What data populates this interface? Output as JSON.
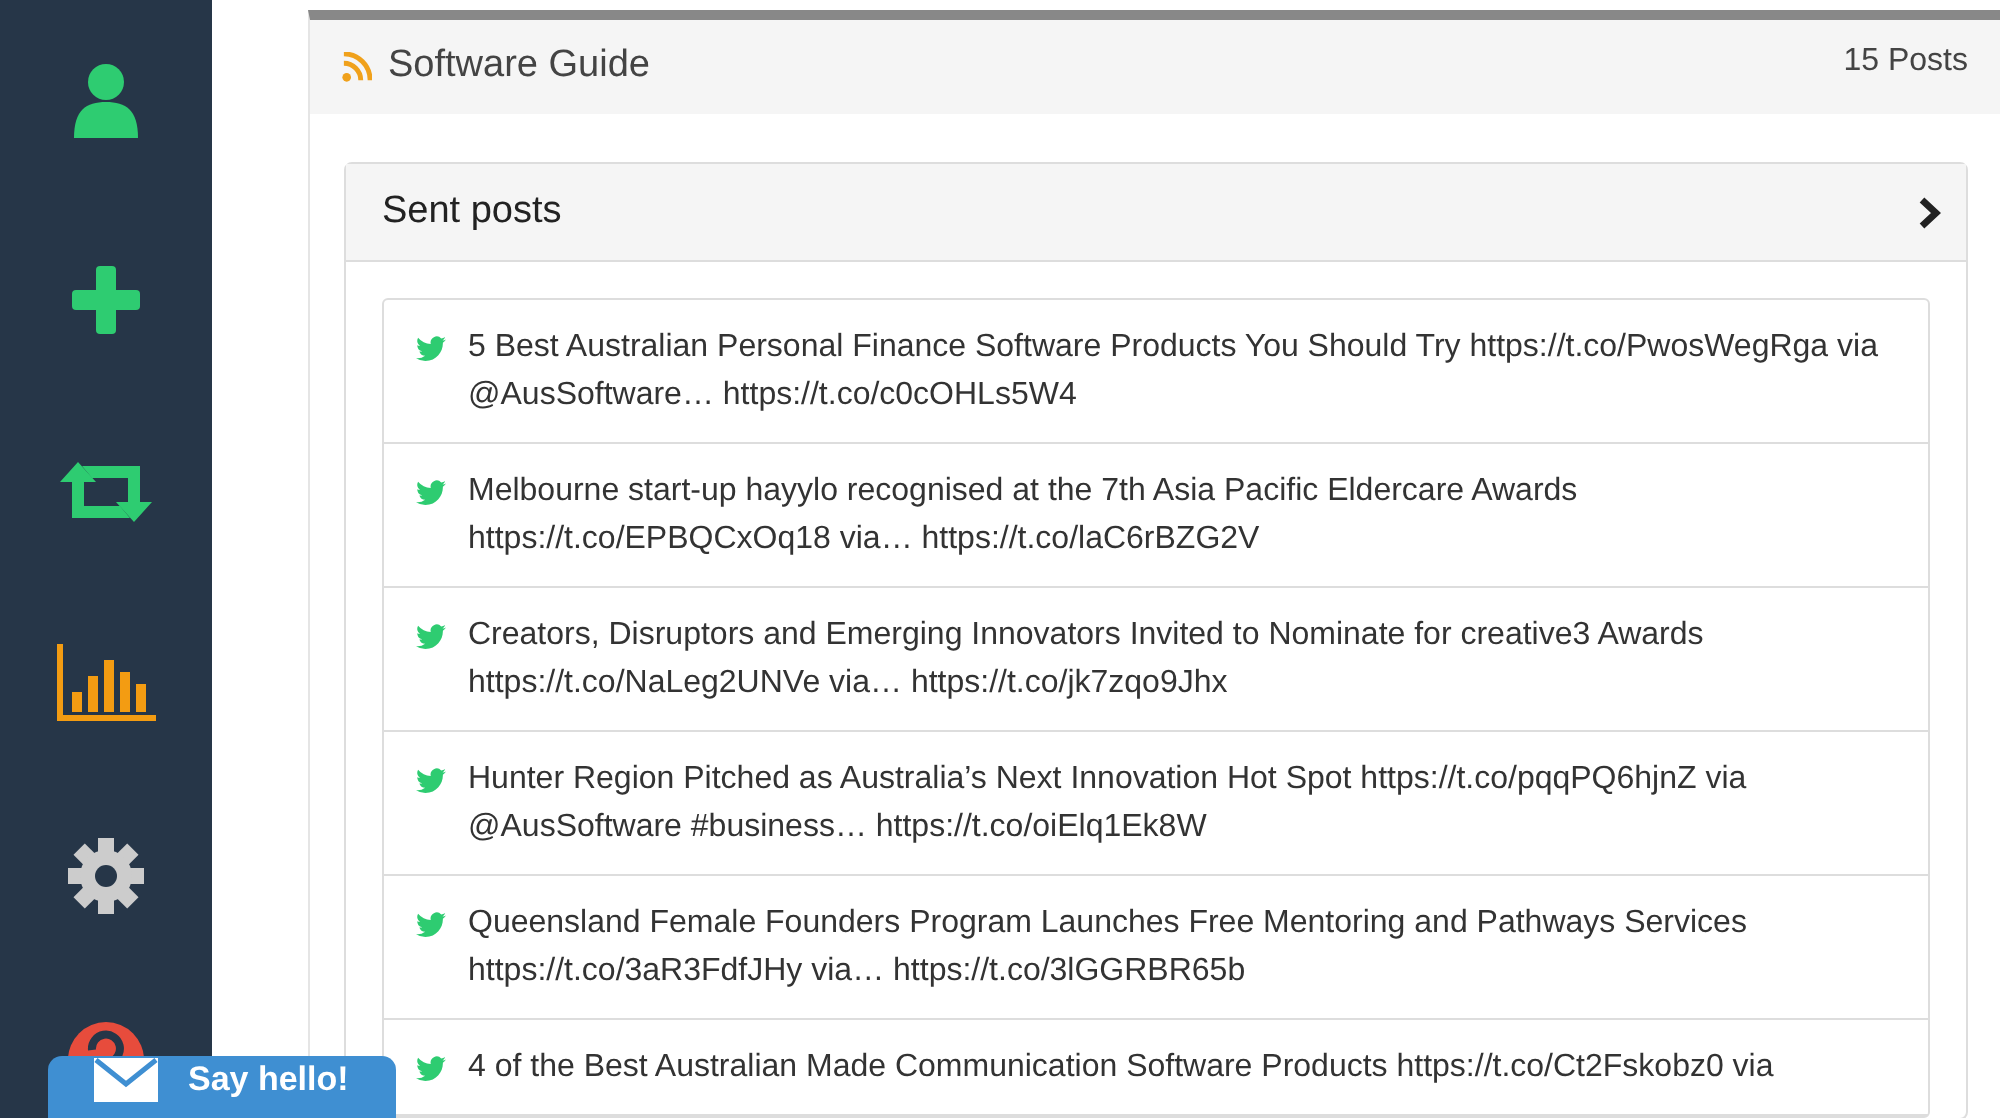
{
  "sidebar": {
    "items": [
      {
        "kind": "user",
        "color": "#2ecc71"
      },
      {
        "kind": "add",
        "color": "#2ecc71"
      },
      {
        "kind": "retweet",
        "color": "#2ecc71"
      },
      {
        "kind": "chart",
        "color": "#f39c12"
      },
      {
        "kind": "settings",
        "color": "#cccccc"
      },
      {
        "kind": "help",
        "color": "#e74c3c"
      }
    ]
  },
  "panel": {
    "title": "Software Guide",
    "count": "15 Posts"
  },
  "sent_posts": {
    "title": "Sent posts",
    "posts": [
      {
        "text": "5 Best Australian Personal Finance Software Products You Should Try https://t.co/PwosWegRga via @AusSoftware… https://t.co/c0cOHLs5W4"
      },
      {
        "text": "Melbourne start-up hayylo recognised at the 7th Asia Pacific Eldercare Awards https://t.co/EPBQCxOq18 via… https://t.co/laC6rBZG2V"
      },
      {
        "text": "Creators, Disruptors and Emerging Innovators Invited to Nominate for creative3 Awards https://t.co/NaLeg2UNVe via… https://t.co/jk7zqo9Jhx"
      },
      {
        "text": "Hunter Region Pitched as Australia’s Next Innovation Hot Spot https://t.co/pqqPQ6hjnZ via @AusSoftware #business… https://t.co/oiElq1Ek8W"
      },
      {
        "text": "Queensland Female Founders Program Launches Free Mentoring and Pathways Services https://t.co/3aR3FdfJHy via… https://t.co/3lGGRBR65b"
      },
      {
        "text": "4 of the Best Australian Made Communication Software Products https://t.co/Ct2Fskobz0 via"
      }
    ]
  },
  "chat_button": {
    "label": "Say hello!"
  }
}
